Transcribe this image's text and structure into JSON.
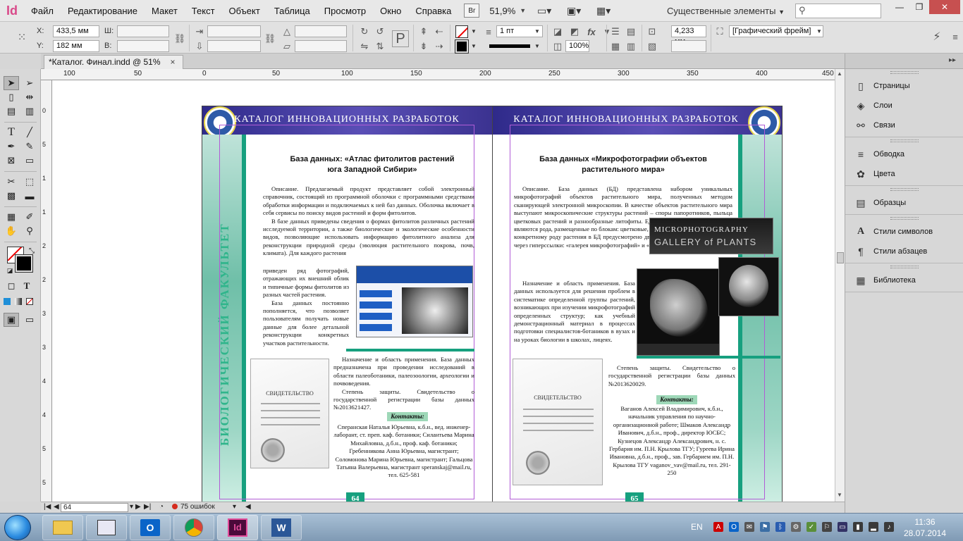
{
  "app": {
    "logo": "Id",
    "zoom": "51,9%",
    "workspace": "Существенные элементы",
    "badge": "Br"
  },
  "menu": [
    "Файл",
    "Редактирование",
    "Макет",
    "Текст",
    "Объект",
    "Таблица",
    "Просмотр",
    "Окно",
    "Справка"
  ],
  "control": {
    "x_label": "X:",
    "x_value": "433,5 мм",
    "y_label": "Y:",
    "y_value": "182 мм",
    "w_label": "Ш:",
    "h_label": "В:",
    "stroke_weight": "1 пт",
    "size_value": "4,233 мм",
    "scale_value": "100%",
    "frame_style": "[Графический фрейм]"
  },
  "tab": {
    "title": "*Каталог. Финал.indd @ 51%",
    "close": "×"
  },
  "ruler": {
    "h": [
      "100",
      "50",
      "0",
      "50",
      "100",
      "150",
      "200",
      "250",
      "300",
      "350",
      "400",
      "450"
    ],
    "v": [
      "0",
      "5",
      "1",
      "1",
      "2",
      "2",
      "3",
      "3",
      "4",
      "4",
      "5",
      "5"
    ]
  },
  "spread": {
    "header_title": "КАТАЛОГ ИННОВАЦИОННЫХ РАЗРАБОТОК",
    "side_title": "БИОЛОГИЧЕСКИЙ ФАКУЛЬТЕТ",
    "left": {
      "title_line1": "База данных: «Атлас фитолитов растений",
      "title_line2": "юга Западной Сибири»",
      "p1": "Описание. Предлагаемый продукт представляет собой электронный справочник, состоящий из программной оболочки с программными средствами обработки информации и подключаемых к ней баз данных. Оболочка включает в себя сервисы по поиску видов растений и форм фитолитов.",
      "p2": "В базе данных приведены сведения о формах фитолитов различных растений исследуемой территории, а также биологические и экологические особенности видов, позволяющие использовать информацию фитолитного анализа для реконструкции природной среды (эволюция растительного покрова, почв, климата). Для каждого растения",
      "p3": "приведен ряд фотографий, отражающих их внешний облик и типичные формы фитолитов из разных частей растения.",
      "p4": "База данных постоянно пополняется, что позволяет пользователям получать новые данные для более детальной реконструкции конкретных участков растительности.",
      "p5": "Назначение и область применения. База данных предназначена при проведении исследований в области палеоботаники, палеозоологии, археологии и почвоведения.",
      "p6": "Степень защиты. Свидетельство о государственной регистрации базы данных №2013621427.",
      "contacts_label": "Контакты:",
      "contacts": "Сперанская Наталья Юрьевна, к.б.н., вед. инженер-лаборант, ст. преп. каф. ботаники; Силантьева Марина Михайловна, д.б.н., проф. каф. ботаники; Гребенникова Анна Юрьевна, магистрант; Соломонова Марина Юрьевна, магистрант; Гальцова Татьяна Валерьевна, магистрант speranskaj@mail.ru, тел. 625-581",
      "page_no": "64",
      "cert_title": "СВИДЕТЕЛЬСТВО"
    },
    "right": {
      "title_line1": "База данных «Микрофотографии объектов",
      "title_line2": "растительного мира»",
      "p1": "Описание. База данных (БД) представлена набором уникальных микрофотографий объектов растительного мира, полученных методом сканирующей электронной микроскопии. В качестве объектов растительного мира выступают микроскопические структуры растений – споры папоротников, пыльца цветковых растений и разнообразные литофиты. Единицей хранения в данной БД являются рода, размещенные по блокам: цветковые, папоротники, мхи и плауны. По конкретному роду растения в БД предусмотрено два режима просмотра материала через гиперссылки: «галерея микрофотографий» и «публикация материала».",
      "p2": "Назначение и область применения. База данных используется для решения проблем в систематике определенной группы растений, возникающих при изучении микрофотографий определенных структур; как учебный демонстрационный материал в процессах подготовки специалистов-ботаников в вузах и на уроках биологии в школах, лицеях.",
      "p3": "Степень защиты. Свидетельство о государственной регистрации базы данных №2013620029.",
      "contacts_label": "Контакты:",
      "contacts": "Ваганов Алексей Владимирович, к.б.н., начальник управления по научно-организационной работе; Шмаков Александр Иванович, д.б.н., проф., директор ЮСБС; Кузнецов Александр Александрович, н. с. Гербария им. П.Н. Крылова ТГУ; Гуреева Ирина Ивановна, д.б.н., проф., зав. Гербарием им. П.Н. Крылова ТГУ vaganov_vav@mail.ru, тел. 291-250",
      "page_no": "65",
      "gallery_line1": "MICROPHOTOGRAPHY",
      "gallery_line2": "GALLERY of PLANTS",
      "cert_title": "СВИДЕТЕЛЬСТВО"
    }
  },
  "status": {
    "page": "64",
    "errors": "75 ошибок"
  },
  "panels": {
    "group1": [
      "Страницы",
      "Слои",
      "Связи"
    ],
    "group2": [
      "Обводка",
      "Цвета"
    ],
    "group3": [
      "Образцы"
    ],
    "group4": [
      "Стили символов",
      "Стили абзацев"
    ],
    "group5": [
      "Библиотека"
    ]
  },
  "taskbar": {
    "lang": "EN",
    "time": "11:36",
    "date": "28.07.2014"
  },
  "colors": {
    "accent_teal": "#17a07f",
    "header_purple": "#3b3290",
    "guide_violet": "#b15cd6"
  }
}
